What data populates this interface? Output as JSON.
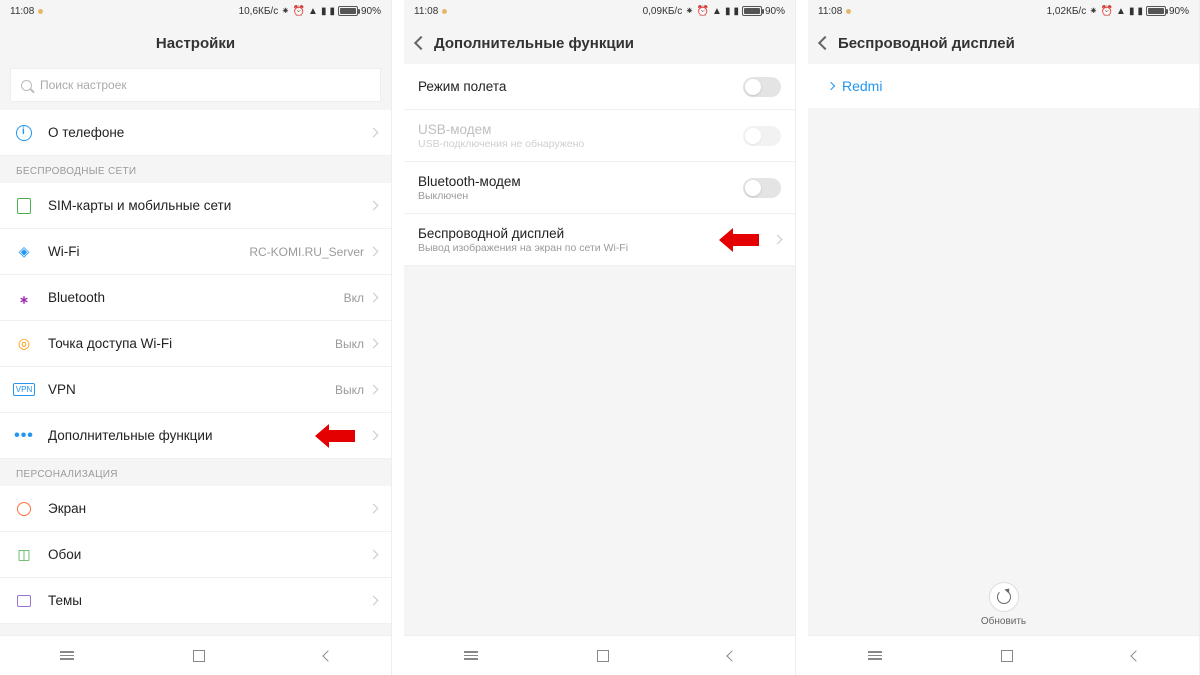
{
  "status": {
    "time": "11:08",
    "battery_pct": "90%",
    "screen1_net": "10,6КБ/с",
    "screen2_net": "0,09КБ/с",
    "screen3_net": "1,02КБ/с"
  },
  "screen1": {
    "title": "Настройки",
    "search_placeholder": "Поиск настроек",
    "about_label": "О телефоне",
    "section_wireless": "БЕСПРОВОДНЫЕ СЕТИ",
    "sim_label": "SIM-карты и мобильные сети",
    "wifi_label": "Wi-Fi",
    "wifi_value": "RC-KOMI.RU_Server",
    "bt_label": "Bluetooth",
    "bt_value": "Вкл",
    "hotspot_label": "Точка доступа Wi-Fi",
    "hotspot_value": "Выкл",
    "vpn_label": "VPN",
    "vpn_value": "Выкл",
    "more_label": "Дополнительные функции",
    "section_personal": "ПЕРСОНАЛИЗАЦИЯ",
    "display_label": "Экран",
    "wallpaper_label": "Обои",
    "themes_label": "Темы"
  },
  "screen2": {
    "title": "Дополнительные функции",
    "airplane_label": "Режим полета",
    "usb_label": "USB-модем",
    "usb_sub": "USB-подключения не обнаружено",
    "bt_tether_label": "Bluetooth-модем",
    "bt_tether_sub": "Выключен",
    "wireless_display_label": "Беспроводной дисплей",
    "wireless_display_sub": "Вывод изображения на экран по сети Wi-Fi"
  },
  "screen3": {
    "title": "Беспроводной дисплей",
    "device_name": "Redmi",
    "refresh_label": "Обновить"
  },
  "icons": {
    "bt_glyph": "⁕",
    "alarm_glyph": "⏰",
    "wifi_glyph": "◉"
  }
}
